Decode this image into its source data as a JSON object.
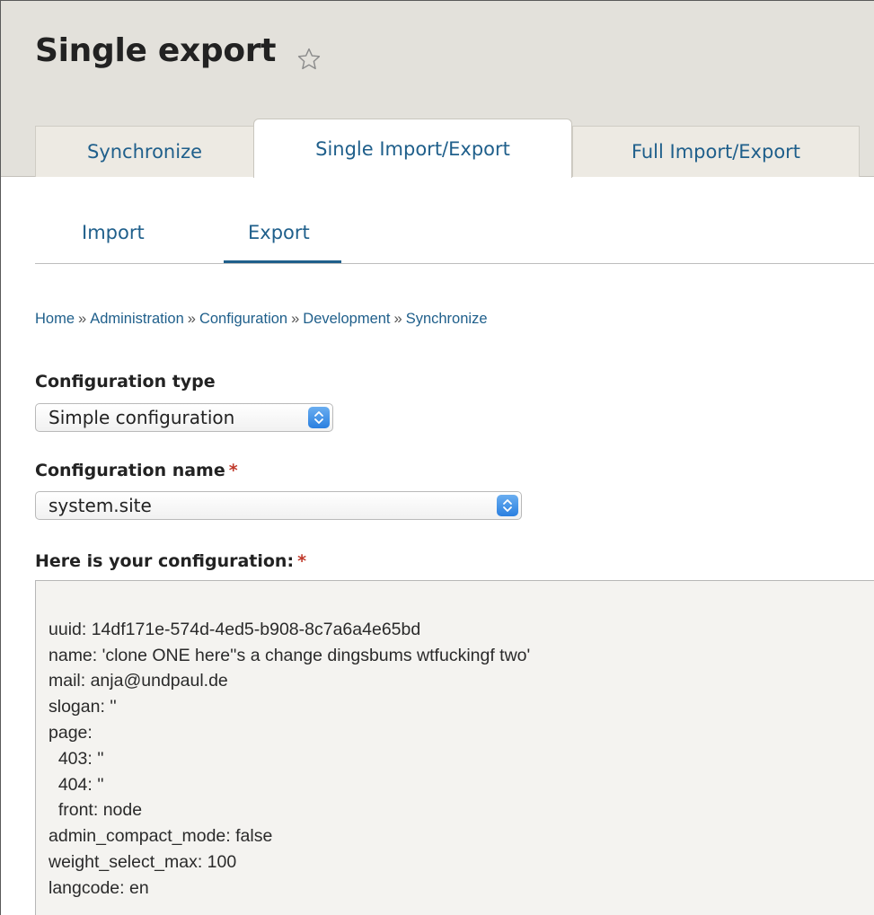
{
  "page": {
    "title": "Single export"
  },
  "tabs": [
    {
      "label": "Synchronize",
      "active": false
    },
    {
      "label": "Single Import/Export",
      "active": true
    },
    {
      "label": "Full Import/Export",
      "active": false
    }
  ],
  "subtabs": [
    {
      "label": "Import",
      "active": false
    },
    {
      "label": "Export",
      "active": true
    }
  ],
  "breadcrumb": {
    "items": [
      "Home",
      "Administration",
      "Configuration",
      "Development",
      "Synchronize"
    ],
    "separator": "»"
  },
  "form": {
    "config_type": {
      "label": "Configuration type",
      "value": "Simple configuration"
    },
    "config_name": {
      "label": "Configuration name",
      "required_marker": "*",
      "value": "system.site"
    },
    "config_output": {
      "label": "Here is your configuration:",
      "required_marker": "*",
      "lines": [
        "uuid: 14df171e-574d-4ed5-b908-8c7a6a4e65bd",
        "name: 'clone ONE here''s a change dingsbums wtfuckingf two'",
        "mail: anja@undpaul.de",
        "slogan: ''",
        "page:",
        "  403: ''",
        "  404: ''",
        "  front: node",
        "admin_compact_mode: false",
        "weight_select_max: 100",
        "langcode: en"
      ]
    }
  },
  "colors": {
    "link": "#1f5f8b",
    "header_bg": "#e3e1db",
    "required": "#c0392b",
    "select_arrow": "#2a7fe0",
    "textarea_bg": "#f4f3f0"
  },
  "icons": {
    "favorite": "star-outline-icon",
    "select_arrow": "up-down-arrows-icon"
  }
}
